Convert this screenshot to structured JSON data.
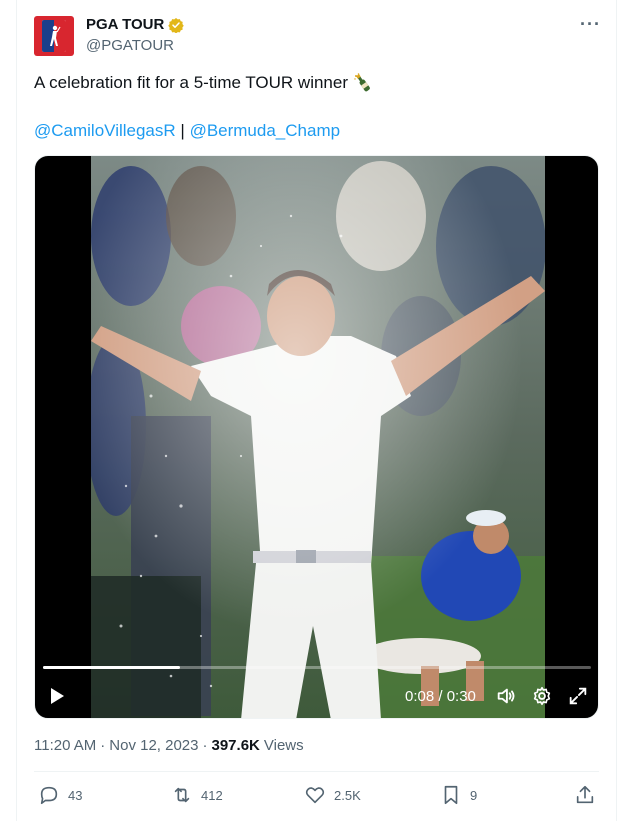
{
  "author": {
    "display_name": "PGA TOUR",
    "handle": "@PGATOUR",
    "avatar_icon": "pga-tour-logo",
    "verified_icon": "verified-gold-badge-icon"
  },
  "tweet": {
    "text": "A celebration fit for a 5-time TOUR winner",
    "emoji_icon": "champagne-bottle-icon",
    "mentions": [
      "@CamiloVillegasR",
      "@Bermuda_Champ"
    ],
    "mention_separator": "|"
  },
  "video": {
    "time_display": "0:08 / 0:30",
    "progress_fraction": 0.25,
    "controls": [
      "play-icon",
      "volume-icon",
      "settings-gear-icon",
      "fullscreen-icon"
    ]
  },
  "meta": {
    "time": "11:20 AM",
    "dot1": "·",
    "date": "Nov 12, 2023",
    "dot2": "·",
    "views_count": "397.6K",
    "views_label": "Views"
  },
  "actions": {
    "replies": "43",
    "reposts": "412",
    "likes": "2.5K",
    "bookmarks": "9"
  },
  "colors": {
    "link": "#1d9bf0",
    "text": "#0f1419",
    "muted": "#536471",
    "brand_red": "#d8262f",
    "brand_blue": "#1b3f8b",
    "verified_gold": "#e2b719"
  }
}
